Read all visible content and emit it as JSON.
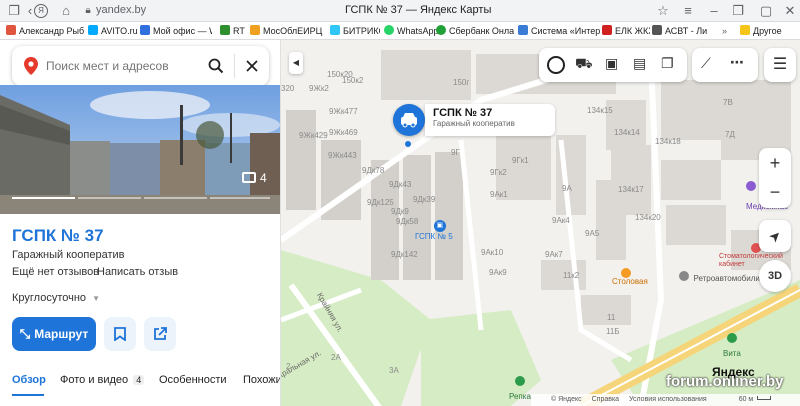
{
  "browser": {
    "url": "yandex.by",
    "title": "ГСПК № 37 — Яндекс Карты",
    "other_bookmarks": "Другое"
  },
  "bookmarks": [
    {
      "label": "Александр Рыбак",
      "color": "#e0553d"
    },
    {
      "label": "AVITO.ru",
      "color": "#00aaff"
    },
    {
      "label": "Мой офис — Wo",
      "color": "#2f6fde"
    },
    {
      "label": "RT",
      "color": "#2f8f2f"
    },
    {
      "label": "МосОблЕИРЦ - о",
      "color": "#f0a020"
    },
    {
      "label": "БИТРИКС",
      "color": "#2fc7f7"
    },
    {
      "label": "WhatsApp",
      "color": "#25d366"
    },
    {
      "label": "Сбербанк Онлайн",
      "color": "#21a038"
    },
    {
      "label": "Система «Интер",
      "color": "#3a7bd5"
    },
    {
      "label": "ЕЛК ЖКХ",
      "color": "#d02020"
    },
    {
      "label": "АСВТ - Ли",
      "color": "#555555"
    }
  ],
  "search": {
    "placeholder": "Поиск мест и адресов"
  },
  "photo": {
    "count": "4"
  },
  "place": {
    "title": "ГСПК № 37",
    "category": "Гаражный кооператив",
    "no_reviews": "Ещё нет отзывов",
    "write_review": "Написать отзыв",
    "hours": "Круглосуточно",
    "route_label": "Маршрут"
  },
  "tabs": [
    {
      "label": "Обзор",
      "active": true
    },
    {
      "label": "Фото и видео",
      "badge": "4"
    },
    {
      "label": "Особенности"
    },
    {
      "label": "Похожие"
    }
  ],
  "map": {
    "popup_title": "ГСПК № 37",
    "popup_subtitle": "Гаражный кооператив",
    "poi_gspk5": "ГСПК № 5",
    "poi_stolovaya": "Столовая",
    "poi_retro": "Ретроавтомобили",
    "poi_stomatology": "Стоматологический кабинет",
    "poi_medcom": "Медкомпас",
    "poi_repka": "Репка",
    "poi_vita": "Вита",
    "street1": "Крайняя ул.",
    "street2": "Кральная ул.",
    "btn_3d": "3D",
    "copyright": "© Яндекс",
    "feedback": "Справка",
    "terms": "Условия использования",
    "scale": "60 м",
    "watermark": "forum.onliner.by",
    "logo": "Яндекс",
    "labels": {
      "l150k2": "150к2",
      "l150k20": "150к20",
      "l150g": "150г",
      "l9zhk2": "9Жк2",
      "l9zhk477": "9Жк477",
      "l9zhk429": "9Жк429",
      "l9zhk469": "9Жк469",
      "l9zhk443": "9Жк443",
      "l9dk78": "9Дк78",
      "l9dk43": "9Дк43",
      "l9dk125": "9Дк125",
      "l9dk39": "9Дк39",
      "l9dk9": "9Дк9",
      "l9dk58": "9Дк58",
      "l9dk142": "9Дк142",
      "l9g": "9Г",
      "l9gk1": "9Гк1",
      "l9gk2": "9Гк2",
      "l9ak1": "9Ак1",
      "l9a": "9А",
      "l9ak4": "9Ак4",
      "l9ak7": "9Ак7",
      "l9ak10": "9Ак10",
      "l9ak9": "9Ак9",
      "l9a5": "9А5",
      "l11k2": "11к2",
      "l11": "11",
      "l134k15": "134к15",
      "l134k14": "134к14",
      "l134k18": "134к18",
      "l134k17": "134к17",
      "l134k20": "134к20",
      "l7b": "7В",
      "l7d": "7Д",
      "l320": "320",
      "l2": "2",
      "l2a": "2А",
      "l3a": "3А",
      "l11b": "11Б"
    }
  },
  "colors": {
    "accent": "#1e74d8",
    "road": "#ffffff",
    "building": "#dcd9d4",
    "park": "#d6ecc4",
    "highway": "#f6d57a"
  }
}
